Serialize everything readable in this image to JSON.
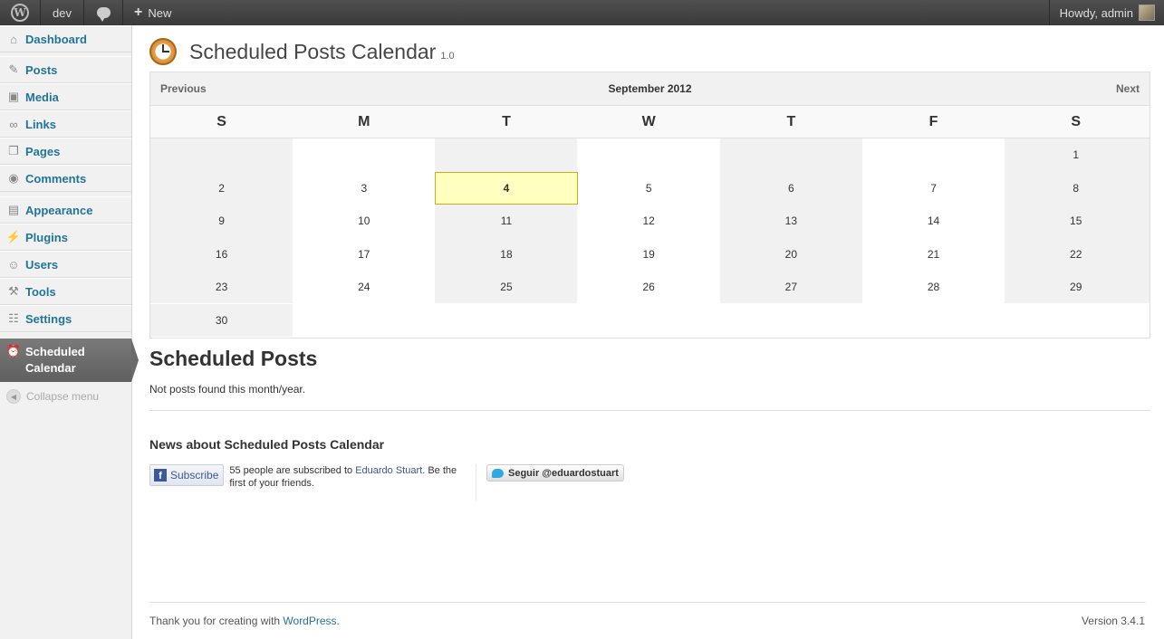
{
  "adminbar": {
    "site_name": "dev",
    "new_label": "New",
    "account_label": "Howdy, admin"
  },
  "sidebar": {
    "items": [
      {
        "label": "Dashboard",
        "icon": "home-icon"
      },
      {
        "label": "Posts",
        "icon": "pushpin-icon"
      },
      {
        "label": "Media",
        "icon": "media-icon"
      },
      {
        "label": "Links",
        "icon": "link-icon"
      },
      {
        "label": "Pages",
        "icon": "pages-icon"
      },
      {
        "label": "Comments",
        "icon": "comment-icon"
      },
      {
        "label": "Appearance",
        "icon": "appearance-icon"
      },
      {
        "label": "Plugins",
        "icon": "plugin-icon"
      },
      {
        "label": "Users",
        "icon": "users-icon"
      },
      {
        "label": "Tools",
        "icon": "tools-icon"
      },
      {
        "label": "Settings",
        "icon": "settings-icon"
      },
      {
        "label": "Scheduled Calendar",
        "icon": "clock-icon"
      }
    ],
    "collapse_label": "Collapse menu"
  },
  "page": {
    "title": "Scheduled Posts Calendar",
    "version": "1.0"
  },
  "calendar": {
    "prev_label": "Previous",
    "next_label": "Next",
    "month_label": "September 2012",
    "weekdays": [
      "S",
      "M",
      "T",
      "W",
      "T",
      "F",
      "S"
    ],
    "weeks": [
      [
        "",
        "",
        "",
        "",
        "",
        "",
        "1"
      ],
      [
        "2",
        "3",
        "4",
        "5",
        "6",
        "7",
        "8"
      ],
      [
        "9",
        "10",
        "11",
        "12",
        "13",
        "14",
        "15"
      ],
      [
        "16",
        "17",
        "18",
        "19",
        "20",
        "21",
        "22"
      ],
      [
        "23",
        "24",
        "25",
        "26",
        "27",
        "28",
        "29"
      ],
      [
        "30",
        "",
        "",
        "",
        "",
        "",
        ""
      ]
    ],
    "today": "4"
  },
  "scheduled": {
    "heading": "Scheduled Posts",
    "empty_message": "Not posts found this month/year."
  },
  "news": {
    "heading": "News about Scheduled Posts Calendar",
    "fb_button": "Subscribe",
    "fb_text_pre": "55 people are subscribed to ",
    "fb_link": "Eduardo Stuart",
    "fb_text_post": ". Be the first of your friends.",
    "twitter_button": "Seguir @eduardostuart"
  },
  "footer": {
    "thanks_pre": "Thank you for creating with ",
    "thanks_link": "WordPress",
    "thanks_post": ".",
    "version": "Version 3.4.1"
  }
}
